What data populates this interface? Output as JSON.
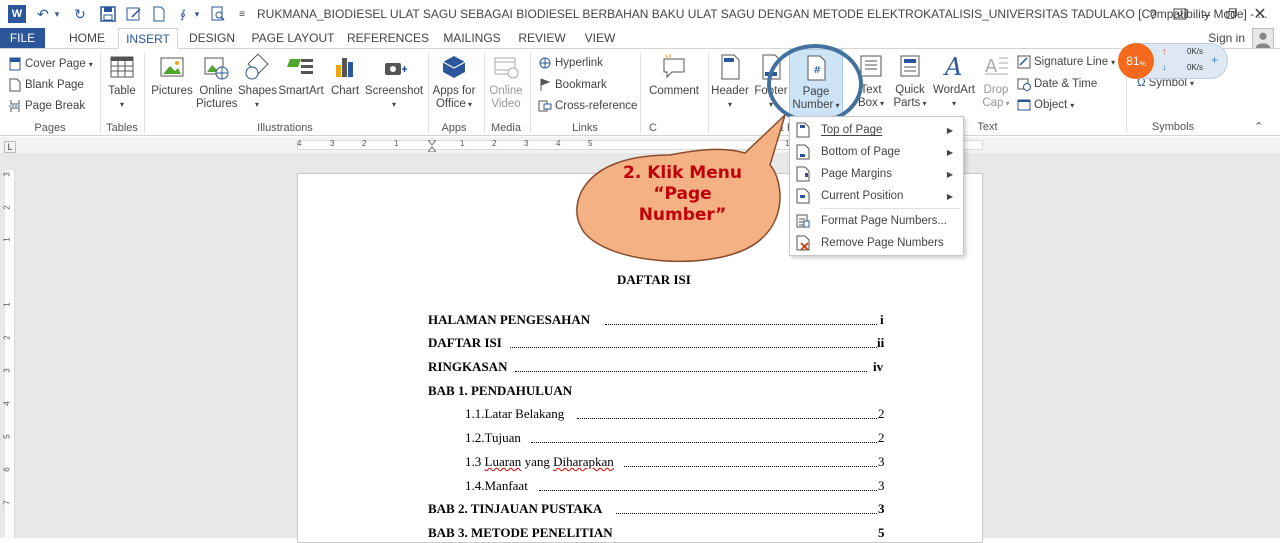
{
  "window": {
    "title": "RUKMANA_BIODIESEL ULAT SAGU SEBAGAI BIODIESEL BERBAHAN BAKU ULAT SAGU DENGAN METODE ELEKTROKATALISIS_UNIVERSITAS TADULAKO [Compatibility Mode] - ...",
    "help": "?",
    "sign_in": "Sign in"
  },
  "tabs": [
    "FILE",
    "HOME",
    "INSERT",
    "DESIGN",
    "PAGE LAYOUT",
    "REFERENCES",
    "MAILINGS",
    "REVIEW",
    "VIEW"
  ],
  "ribbon": {
    "pages": {
      "cover_page": "Cover Page",
      "blank_page": "Blank Page",
      "page_break": "Page Break",
      "label": "Pages"
    },
    "tables": {
      "table": "Table",
      "label": "Tables"
    },
    "illustrations": {
      "pictures": "Pictures",
      "online_pictures_1": "Online",
      "online_pictures_2": "Pictures",
      "shapes": "Shapes",
      "smartart": "SmartArt",
      "chart": "Chart",
      "screenshot": "Screenshot",
      "label": "Illustrations"
    },
    "apps": {
      "apps_for_office_1": "Apps for",
      "apps_for_office_2": "Office",
      "label": "Apps"
    },
    "media": {
      "online_video_1": "Online",
      "online_video_2": "Video",
      "label": "Media"
    },
    "links": {
      "hyperlink": "Hyperlink",
      "bookmark": "Bookmark",
      "cross_reference": "Cross-reference",
      "label": "Links"
    },
    "comments": {
      "comment": "Comment",
      "label": "C"
    },
    "header_footer": {
      "header": "Header",
      "footer": "Footer",
      "page_number_1": "Page",
      "page_number_2": "Number",
      "label": "& F"
    },
    "text": {
      "text_box_1": "Text",
      "text_box_2": "Box",
      "quick_parts_1": "Quick",
      "quick_parts_2": "Parts",
      "wordart": "WordArt",
      "drop_cap_1": "Drop",
      "drop_cap_2": "Cap",
      "signature_line": "Signature Line",
      "date_time": "Date & Time",
      "object": "Object",
      "label": "Text"
    },
    "symbols": {
      "equation": "π",
      "symbol": "Symbol",
      "label": "Symbols"
    }
  },
  "network": {
    "percent": "81",
    "percent_unit": "%",
    "up": "0K/s",
    "down": "0K/s"
  },
  "page_number_menu": [
    {
      "label": "Top of Page",
      "submenu": true
    },
    {
      "label": "Bottom of Page",
      "submenu": true
    },
    {
      "label": "Page Margins",
      "submenu": true
    },
    {
      "label": "Current Position",
      "submenu": true
    },
    {
      "label": "Format Page Numbers...",
      "submenu": false
    },
    {
      "label": "Remove Page Numbers",
      "submenu": false
    }
  ],
  "callout": {
    "line1": "2. Klik Menu",
    "line2": "“Page",
    "line3": "Number”"
  },
  "ruler": [
    "4",
    "3",
    "2",
    "1",
    "1",
    "2",
    "3",
    "4",
    "5",
    "11"
  ],
  "vruler": [
    "3",
    "2",
    "1",
    "1",
    "2",
    "3",
    "4",
    "5",
    "6",
    "7"
  ],
  "document": {
    "heading": "DAFTAR ISI",
    "toc": [
      {
        "text": "HALAMAN PENGESAHAN",
        "page": "i",
        "bold": true,
        "indent": false
      },
      {
        "text": "DAFTAR ISI",
        "page": "ii",
        "bold": true,
        "indent": false
      },
      {
        "text": "RINGKASAN",
        "page": "iv",
        "bold": true,
        "indent": false
      },
      {
        "text": "BAB 1. PENDAHULUAN",
        "page": "",
        "bold": true,
        "indent": false
      },
      {
        "text": "1.1.Latar Belakang",
        "page": "2",
        "bold": false,
        "indent": true
      },
      {
        "text": "1.2.Tujuan",
        "page": "2",
        "bold": false,
        "indent": true
      },
      {
        "text_prefix": "1.3 ",
        "squig1": "Luaran",
        "mid": " yang ",
        "squig2": "Diharapkan",
        "page": "3",
        "bold": false,
        "indent": true
      },
      {
        "text": "1.4.Manfaat",
        "page": "3",
        "bold": false,
        "indent": true
      },
      {
        "text": "BAB 2. TINJAUAN PUSTAKA",
        "page": "3",
        "bold": true,
        "indent": false
      },
      {
        "text": "BAB 3. METODE PENELITIAN",
        "page": "5",
        "bold": true,
        "indent": false
      }
    ]
  },
  "colors": {
    "accent": "#2b579a",
    "callout_fill": "#f4b183",
    "callout_text": "#c0000a",
    "ring": "#41719c",
    "highlight": "#cde4f7"
  }
}
